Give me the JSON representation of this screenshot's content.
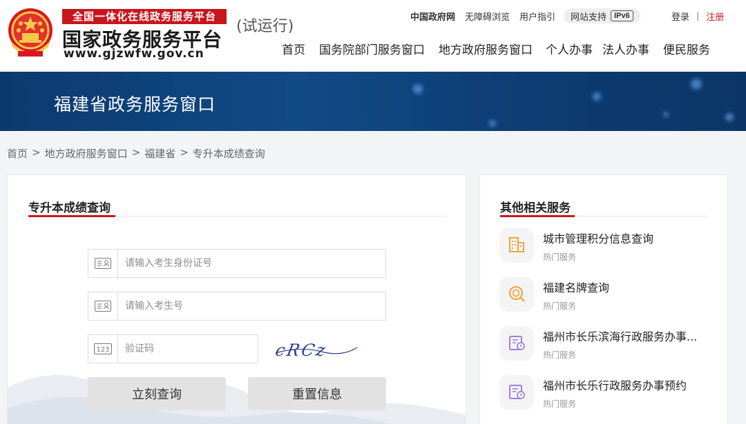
{
  "header": {
    "logo_top": "全国一体化在线政务服务平台",
    "logo_name": "国家政务服务平台",
    "logo_url": "www.gjzwfw.gov.cn",
    "trial": "(试运行)",
    "top_links": {
      "gov_site": "中国政府网",
      "accessible": "无障碍浏览",
      "user_guide": "用户指引",
      "support": "网站支持",
      "ipv6": "IPv6"
    },
    "login": "登录",
    "separator": "|",
    "register": "注册",
    "nav": [
      "首页",
      "国务院部门服务窗口",
      "地方政府服务窗口",
      "个人办事",
      "法人办事",
      "便民服务"
    ]
  },
  "banner": {
    "title": "福建省政务服务窗口"
  },
  "breadcrumb": {
    "items": [
      "首页",
      "地方政府服务窗口",
      "福建省",
      "专升本成绩查询"
    ],
    "separator": ">"
  },
  "form": {
    "title": "专升本成绩查询",
    "id_placeholder": "请输入考生身份证号",
    "exam_no_placeholder": "请输入考生号",
    "captcha_placeholder": "验证码",
    "captcha_icon_text": "123",
    "captcha_text": "cRCz",
    "submit_label": "立刻查询",
    "reset_label": "重置信息"
  },
  "related": {
    "title": "其他相关服务",
    "items": [
      {
        "name": "城市管理积分信息查询",
        "tag": "热门服务",
        "icon": "building-icon",
        "color": "#f0a433"
      },
      {
        "name": "福建名牌查询",
        "tag": "热门服务",
        "icon": "brand-search-icon",
        "color": "#f0a433"
      },
      {
        "name": "福州市长乐滨海行政服务办事...",
        "tag": "热门服务",
        "icon": "appointment-calendar-icon",
        "color": "#9b83d6"
      },
      {
        "name": "福州市长乐行政服务办事预约",
        "tag": "热门服务",
        "icon": "appointment-calendar-icon",
        "color": "#9b83d6"
      }
    ]
  },
  "colors": {
    "brand_red": "#c8161d",
    "banner_blue": "#124a86",
    "button_gray": "#e2e2e2"
  }
}
